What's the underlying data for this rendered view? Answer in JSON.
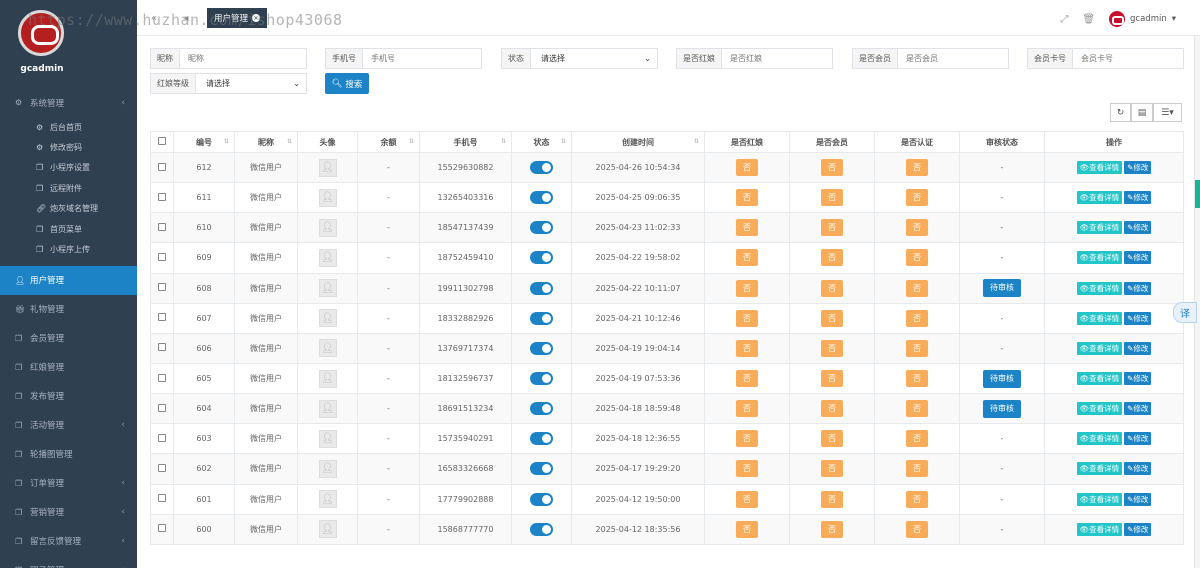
{
  "watermark": "https://www.huzhan.com/ishop43068",
  "sidebar": {
    "brand": "gcadmin",
    "system": {
      "label": "系统管理",
      "icon": "gears-icon"
    },
    "sub_items": [
      {
        "label": "后台首页",
        "icon": "gear-icon"
      },
      {
        "label": "修改密码",
        "icon": "gear-icon"
      },
      {
        "label": "小程序设置",
        "icon": "copy-icon"
      },
      {
        "label": "远程附件",
        "icon": "copy-icon"
      },
      {
        "label": "炮灰域名管理",
        "icon": "link-icon"
      },
      {
        "label": "首页菜单",
        "icon": "copy-icon"
      },
      {
        "label": "小程序上传",
        "icon": "copy-icon"
      }
    ],
    "items": [
      {
        "label": "用户管理",
        "icon": "user-icon",
        "active": true,
        "arrow": false
      },
      {
        "label": "礼物管理",
        "icon": "gift-icon",
        "arrow": false
      },
      {
        "label": "会员管理",
        "icon": "copy-icon",
        "arrow": false
      },
      {
        "label": "红娘管理",
        "icon": "copy-icon",
        "arrow": false
      },
      {
        "label": "发布管理",
        "icon": "copy-icon",
        "arrow": false
      },
      {
        "label": "活动管理",
        "icon": "copy-icon",
        "arrow": true
      },
      {
        "label": "轮播图管理",
        "icon": "copy-icon",
        "arrow": false
      },
      {
        "label": "订单管理",
        "icon": "copy-icon",
        "arrow": true
      },
      {
        "label": "营销管理",
        "icon": "copy-icon",
        "arrow": true
      },
      {
        "label": "留言反馈管理",
        "icon": "copy-icon",
        "arrow": true
      },
      {
        "label": "圈子管理",
        "icon": "copy-icon",
        "arrow": true
      }
    ]
  },
  "topbar": {
    "active_tab": "用户管理",
    "username": "gcadmin"
  },
  "filters": {
    "nickname": {
      "label": "昵称",
      "placeholder": "昵称"
    },
    "phone": {
      "label": "手机号",
      "placeholder": "手机号"
    },
    "status": {
      "label": "状态",
      "value": "请选择"
    },
    "is_matchmaker": {
      "label": "是否红娘",
      "placeholder": "是否红娘"
    },
    "is_member": {
      "label": "是否会员",
      "placeholder": "是否会员"
    },
    "card_no": {
      "label": "会员卡号",
      "placeholder": "会员卡号"
    },
    "level": {
      "label": "红娘等级",
      "value": "请选择"
    },
    "search_label": "搜索"
  },
  "table": {
    "columns": [
      "编号",
      "昵称",
      "头像",
      "余额",
      "手机号",
      "状态",
      "创建时间",
      "是否红娘",
      "是否会员",
      "是否认证",
      "审核状态",
      "操作"
    ],
    "view_label": "查看详情",
    "edit_label": "修改",
    "rows": [
      {
        "id": "612",
        "nick": "微信用户",
        "balance": "-",
        "phone": "15529630882",
        "created": "2025-04-26 10:54:34",
        "matchmaker": "否",
        "member": "否",
        "verified": "否",
        "audit": "-"
      },
      {
        "id": "611",
        "nick": "微信用户",
        "balance": "-",
        "phone": "13265403316",
        "created": "2025-04-25 09:06:35",
        "matchmaker": "否",
        "member": "否",
        "verified": "否",
        "audit": "-"
      },
      {
        "id": "610",
        "nick": "微信用户",
        "balance": "-",
        "phone": "18547137439",
        "created": "2025-04-23 11:02:33",
        "matchmaker": "否",
        "member": "否",
        "verified": "否",
        "audit": "-"
      },
      {
        "id": "609",
        "nick": "微信用户",
        "balance": "-",
        "phone": "18752459410",
        "created": "2025-04-22 19:58:02",
        "matchmaker": "否",
        "member": "否",
        "verified": "否",
        "audit": "-"
      },
      {
        "id": "608",
        "nick": "微信用户",
        "balance": "-",
        "phone": "19911302798",
        "created": "2025-04-22 10:11:07",
        "matchmaker": "否",
        "member": "否",
        "verified": "否",
        "audit": "待审核"
      },
      {
        "id": "607",
        "nick": "微信用户",
        "balance": "-",
        "phone": "18332882926",
        "created": "2025-04-21 10:12:46",
        "matchmaker": "否",
        "member": "否",
        "verified": "否",
        "audit": "-"
      },
      {
        "id": "606",
        "nick": "微信用户",
        "balance": "-",
        "phone": "13769717374",
        "created": "2025-04-19 19:04:14",
        "matchmaker": "否",
        "member": "否",
        "verified": "否",
        "audit": "-"
      },
      {
        "id": "605",
        "nick": "微信用户",
        "balance": "-",
        "phone": "18132596737",
        "created": "2025-04-19 07:53:36",
        "matchmaker": "否",
        "member": "否",
        "verified": "否",
        "audit": "待审核"
      },
      {
        "id": "604",
        "nick": "微信用户",
        "balance": "-",
        "phone": "18691513234",
        "created": "2025-04-18 18:59:48",
        "matchmaker": "否",
        "member": "否",
        "verified": "否",
        "audit": "待审核"
      },
      {
        "id": "603",
        "nick": "微信用户",
        "balance": "-",
        "phone": "15735940291",
        "created": "2025-04-18 12:36:55",
        "matchmaker": "否",
        "member": "否",
        "verified": "否",
        "audit": "-"
      },
      {
        "id": "602",
        "nick": "微信用户",
        "balance": "-",
        "phone": "16583326668",
        "created": "2025-04-17 19:29:20",
        "matchmaker": "否",
        "member": "否",
        "verified": "否",
        "audit": "-"
      },
      {
        "id": "601",
        "nick": "微信用户",
        "balance": "-",
        "phone": "17779902888",
        "created": "2025-04-12 19:50:00",
        "matchmaker": "否",
        "member": "否",
        "verified": "否",
        "audit": "-"
      },
      {
        "id": "600",
        "nick": "微信用户",
        "balance": "-",
        "phone": "15868777770",
        "created": "2025-04-12 18:35:56",
        "matchmaker": "否",
        "member": "否",
        "verified": "否",
        "audit": "-"
      }
    ]
  },
  "translate_label": "译"
}
